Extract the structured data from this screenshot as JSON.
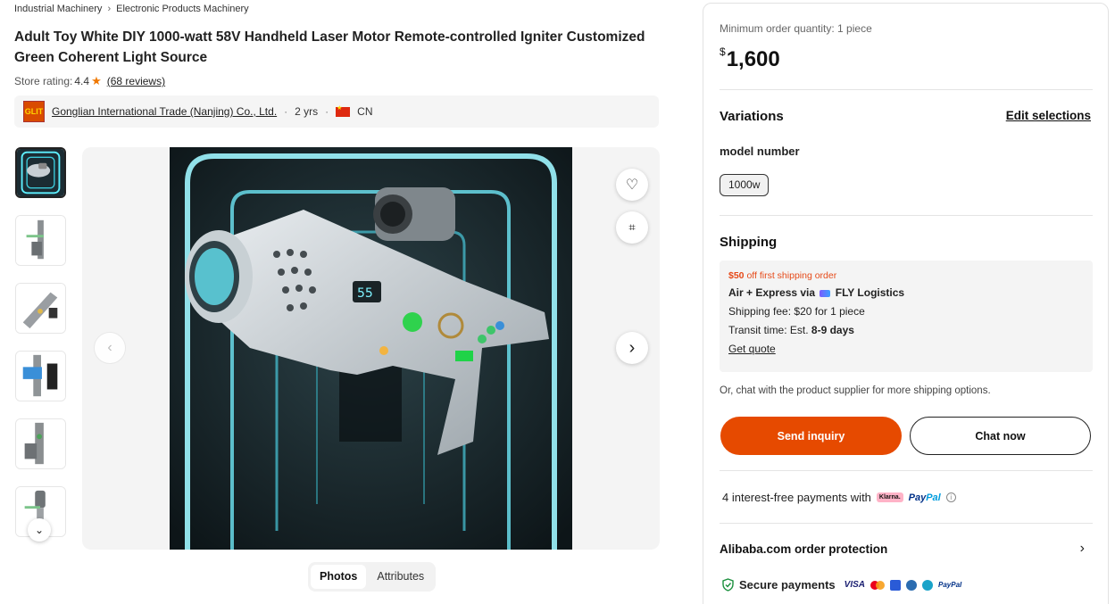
{
  "breadcrumb": [
    "Industrial Machinery",
    "Electronic Products Machinery"
  ],
  "product": {
    "title": "Adult Toy White DIY 1000-watt 58V Handheld Laser Motor Remote-controlled Igniter Customized Green Coherent Light Source",
    "rating_label": "Store rating:",
    "rating_value": "4.4",
    "reviews": "(68 reviews)"
  },
  "supplier": {
    "logo_text": "GLIT",
    "name": "Gonglian International Trade (Nanjing) Co., Ltd.",
    "years": "2 yrs",
    "country": "CN"
  },
  "gallery": {
    "thumbnail_count": 6,
    "tabs": [
      "Photos",
      "Attributes"
    ],
    "active_tab": "Photos",
    "icons": [
      "heart-icon",
      "visual-search-icon",
      "chevron-left-icon",
      "chevron-right-icon",
      "chevron-down-icon"
    ]
  },
  "order": {
    "moq": "Minimum order quantity: 1 piece",
    "currency": "$",
    "price": "1,600"
  },
  "variations": {
    "title": "Variations",
    "edit_label": "Edit selections",
    "attribute": "model number",
    "selected_option": "1000w"
  },
  "shipping": {
    "title": "Shipping",
    "promo_amount": "$50",
    "promo_text": " off first shipping order",
    "method": "Air + Express via",
    "carrier": "FLY Logistics",
    "fee": "Shipping fee: $20 for 1 piece",
    "transit_label": "Transit time: Est. ",
    "transit_days": "8-9 days",
    "quote_label": "Get quote",
    "chat_note": "Or, chat with the product supplier for more shipping options."
  },
  "actions": {
    "inquiry": "Send inquiry",
    "chat": "Chat now"
  },
  "payments": {
    "installments": "4 interest-free payments with",
    "klarna": "Klarna.",
    "paypal_a": "Pay",
    "paypal_b": "Pal",
    "protection": "Alibaba.com order protection",
    "secure": "Secure payments",
    "visa": "VISA",
    "paypal_small": "PayPal"
  },
  "colors": {
    "accent": "#e64a00",
    "promo": "#e64a19",
    "star": "#f07800",
    "shield": "#1a8f3c"
  }
}
